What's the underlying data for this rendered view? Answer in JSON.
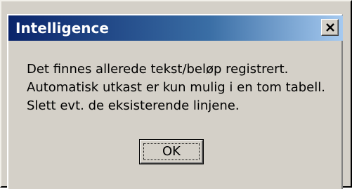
{
  "window": {
    "title": "Intelligence",
    "close_icon": "close-icon"
  },
  "message": {
    "lines": [
      "Det finnes allerede tekst/beløp registrert.",
      "Automatisk utkast er kun mulig i en tom tabell.",
      "Slett evt. de eksisterende linjene."
    ]
  },
  "buttons": {
    "ok_label": "OK"
  },
  "colors": {
    "title_bar_start": "#0a246a",
    "title_bar_end": "#a6caf0",
    "dialog_face": "#d4d0c8"
  }
}
